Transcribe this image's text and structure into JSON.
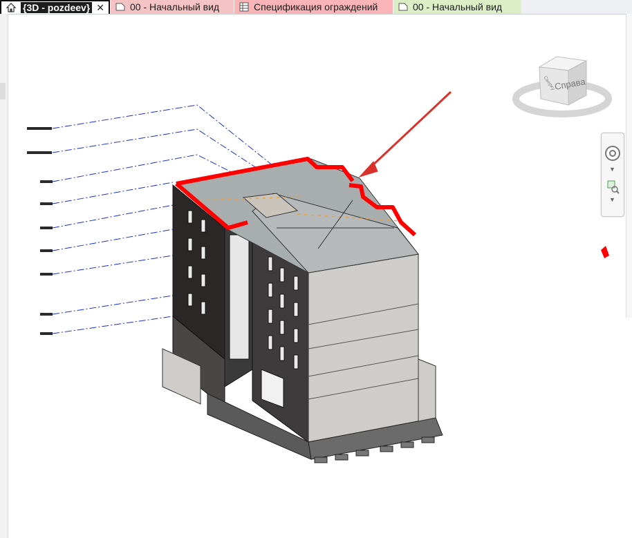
{
  "tabs": [
    {
      "label": "{3D - pozdeev}",
      "icon": "home-3d-icon",
      "close": "✕",
      "active": true,
      "color": "#ffffff"
    },
    {
      "label": "00 - Начальный вид",
      "icon": "floor-plan-view-icon",
      "color": "#f6c3c5"
    },
    {
      "label": "Спецификация ограждений",
      "icon": "schedule-table-icon",
      "color": "#f9b4b8"
    },
    {
      "label": "00 - Начальный вид",
      "icon": "floor-plan-view-icon",
      "color": "#dbeec6"
    }
  ],
  "viewcube": {
    "face_label": "Справа",
    "top_label": "Сверху"
  },
  "colors": {
    "highlight_railing": "#ff0000",
    "annotation_arrow": "#d9322b",
    "level_lines": "#1a2fd6"
  }
}
